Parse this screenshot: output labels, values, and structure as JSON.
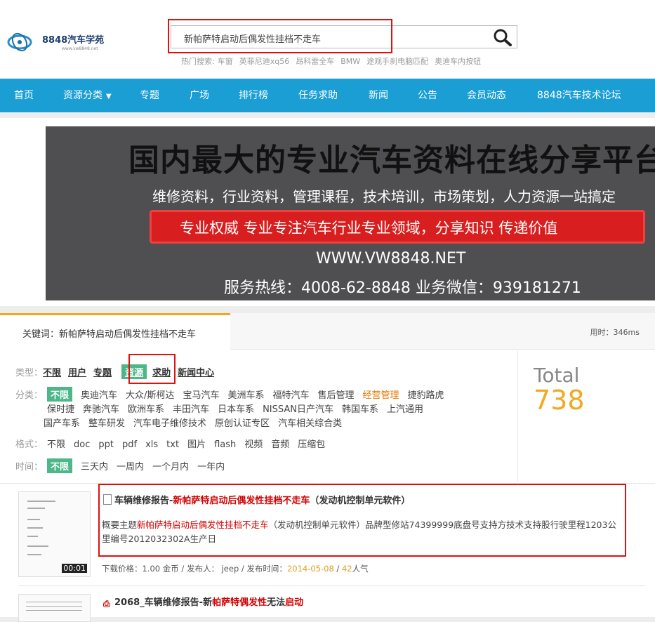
{
  "logo": {
    "text": "8848汽车学苑",
    "sub": "www.vw8848.net"
  },
  "search": {
    "value": "新帕萨特启动后偶发性挂档不走车"
  },
  "hot": {
    "label": "热门搜索:",
    "items": [
      "车窗",
      "英菲尼迪xq56",
      "昂科雷全车",
      "BMW",
      "途观手刹电脑匹配",
      "奥迪车内按钮"
    ]
  },
  "nav": {
    "items": [
      "首页",
      "资源分类",
      "专题",
      "广场",
      "排行榜",
      "任务求助",
      "新闻",
      "公告",
      "会员动态",
      "8848汽车技术论坛"
    ]
  },
  "banner": {
    "title": "国内最大的专业汽车资料在线分享平台",
    "line2": "维修资料，行业资料，管理课程，技术培训，市场策划，人力资源一站搞定",
    "slogan": "专业权威 专业专注汽车行业专业领域，分享知识 传递价值",
    "url": "WWW.VW8848.NET",
    "hotline": "服务热线：4008-62-8848  业务微信：939181271"
  },
  "results": {
    "keyword_label": "关键词：新帕萨特启动后偶发性挂档不走车",
    "timing": "用时：346ms",
    "total_label": "Total",
    "total": "738"
  },
  "filters": {
    "type": {
      "label": "类型：",
      "options": [
        "不限",
        "用户",
        "专题",
        "资源",
        "求助",
        "新闻中心"
      ]
    },
    "category": {
      "label": "分类：",
      "selected": "不限",
      "row1": [
        "奥迪汽车",
        "大众/斯柯达",
        "宝马汽车",
        "美洲车系",
        "福特汽车",
        "售后管理",
        "经营管理",
        "捷豹路虎"
      ],
      "row2": [
        "保时捷",
        "奔驰汽车",
        "欧洲车系",
        "丰田汽车",
        "日本车系",
        "NISSAN日产汽车",
        "韩国车系",
        "上汽通用"
      ],
      "row3": [
        "国产车系",
        "整车研发",
        "汽车电子维修技术",
        "原创认证专区",
        "汽车相关综合类"
      ]
    },
    "format": {
      "label": "格式：",
      "options": [
        "不限",
        "doc",
        "ppt",
        "pdf",
        "xls",
        "txt",
        "图片",
        "flash",
        "视频",
        "音频",
        "压缩包"
      ]
    },
    "time": {
      "label": "时间：",
      "selected": "不限",
      "options": [
        "三天内",
        "一周内",
        "一个月内",
        "一年内"
      ]
    }
  },
  "items": [
    {
      "title_pre": "车辆维修报告-",
      "title_hl": "新帕萨特启动后偶发性挂档不走车",
      "title_post": "（发动机控制单元软件）",
      "desc_pre": "概要主题",
      "desc_hl": "新帕萨特启动后偶发性挂档不走车",
      "desc_post": "（发动机控制单元软件）品牌型修站74399999底盘号支持方技术支持股行驶里程1203公里编号2012032302A生产日",
      "duration": "00:01",
      "meta_pre": "下载价格：1.00 金币 / 发布人： jeep / 发布时间：",
      "date": "2014-05-08",
      "meta_sep": " / ",
      "views": "42",
      "views_suffix": "人气"
    },
    {
      "title_pre": "2068_车辆维修报告-新",
      "title_hl": "帕萨特偶发性",
      "title_mid": "无法",
      "title_hl2": "启动"
    }
  ]
}
